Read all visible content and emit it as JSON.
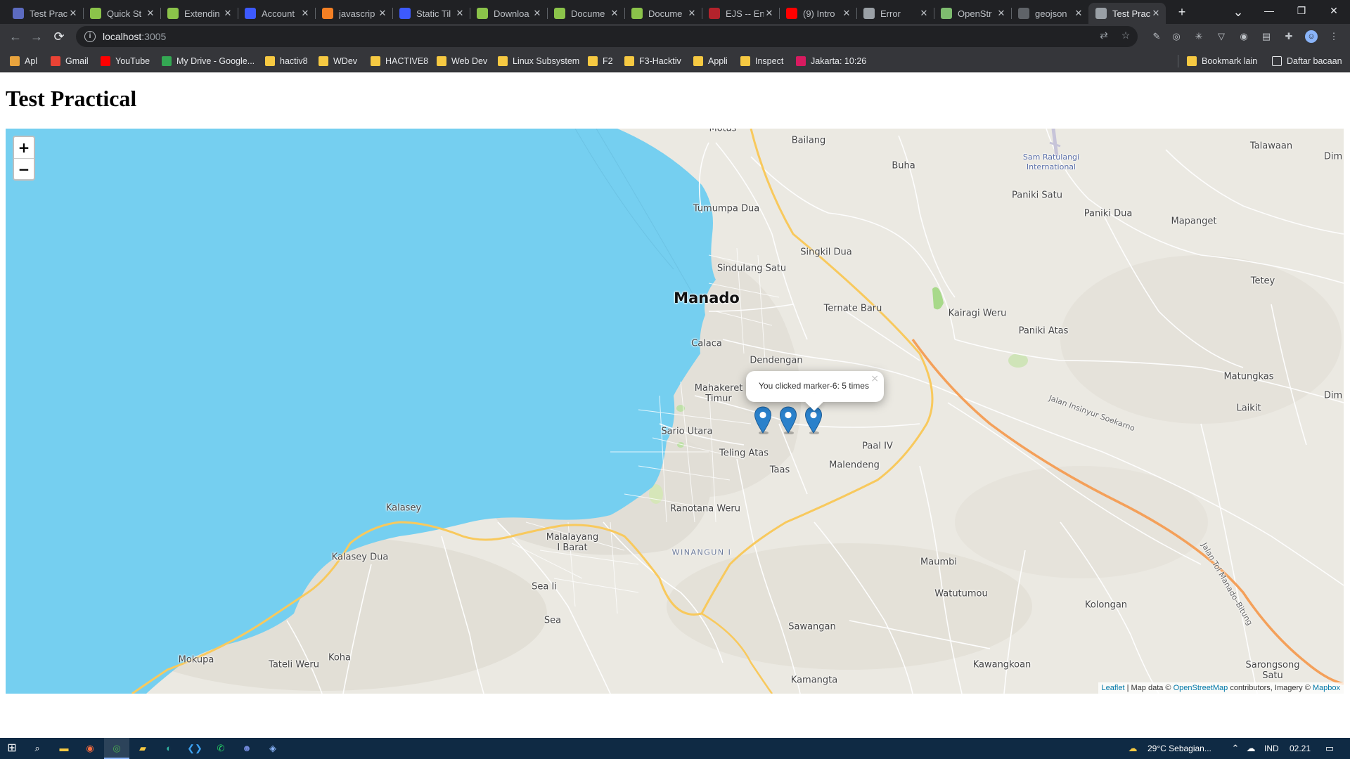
{
  "browser": {
    "tabs": [
      {
        "title": "Test Prac",
        "favicon_color": "#5c6bc0",
        "active": false
      },
      {
        "title": "Quick St",
        "favicon_color": "#8bc34a",
        "active": false
      },
      {
        "title": "Extendin",
        "favicon_color": "#8bc34a",
        "active": false
      },
      {
        "title": "Account",
        "favicon_color": "#3d5afe",
        "active": false
      },
      {
        "title": "javascrip",
        "favicon_color": "#f48024",
        "active": false
      },
      {
        "title": "Static Til",
        "favicon_color": "#3d5afe",
        "active": false
      },
      {
        "title": "Downloa",
        "favicon_color": "#8bc34a",
        "active": false
      },
      {
        "title": "Docume",
        "favicon_color": "#8bc34a",
        "active": false
      },
      {
        "title": "Docume",
        "favicon_color": "#8bc34a",
        "active": false
      },
      {
        "title": "EJS -- En",
        "favicon_color": "#b4232c",
        "active": false
      },
      {
        "title": "(9) Intro",
        "favicon_color": "#ff0000",
        "active": false
      },
      {
        "title": "Error",
        "favicon_color": "#9aa0a6",
        "active": false
      },
      {
        "title": "OpenStr",
        "favicon_color": "#7ebc6f",
        "active": false
      },
      {
        "title": "geojson",
        "favicon_color": "#5f6368",
        "active": false
      },
      {
        "title": "Test Prac",
        "favicon_color": "#9aa0a6",
        "active": true
      }
    ],
    "new_tab_label": "+",
    "url": {
      "host": "localhost",
      "port": ":3005"
    },
    "bookmarks": [
      {
        "label": "Apl",
        "icon": "grid-icon",
        "color": "#e8a33d"
      },
      {
        "label": "Gmail",
        "icon": "gmail-icon",
        "color": "#ea4335"
      },
      {
        "label": "YouTube",
        "icon": "youtube-icon",
        "color": "#ff0000"
      },
      {
        "label": "My Drive - Google...",
        "icon": "drive-icon",
        "color": "#34a853"
      },
      {
        "label": "hactiv8",
        "icon": "folder-icon",
        "color": "#f6c942"
      },
      {
        "label": "WDev",
        "icon": "folder-icon",
        "color": "#f6c942"
      },
      {
        "label": "HACTIVE8",
        "icon": "folder-icon",
        "color": "#f6c942"
      },
      {
        "label": "Web Dev",
        "icon": "folder-icon",
        "color": "#f6c942"
      },
      {
        "label": "Linux Subsystem",
        "icon": "folder-icon",
        "color": "#f6c942"
      },
      {
        "label": "F2",
        "icon": "folder-icon",
        "color": "#f6c942"
      },
      {
        "label": "F3-Hacktiv",
        "icon": "folder-icon",
        "color": "#f6c942"
      },
      {
        "label": "Appli",
        "icon": "folder-icon",
        "color": "#f6c942"
      },
      {
        "label": "Inspect",
        "icon": "folder-icon",
        "color": "#f6c942"
      },
      {
        "label": "Jakarta: 10:26",
        "icon": "clock-site-icon",
        "color": "#d81b60"
      }
    ],
    "other_bookmarks": "Bookmark lain",
    "reading_list": "Daftar bacaan"
  },
  "page": {
    "title": "Test Practical"
  },
  "map": {
    "zoom_in": "+",
    "zoom_out": "−",
    "sea_color": "#75cff0",
    "land_color": "#ebe9e2",
    "places": [
      {
        "name": "Manado",
        "kind": "city"
      },
      {
        "name": "Bailang",
        "kind": "place"
      },
      {
        "name": "Buha",
        "kind": "place"
      },
      {
        "name": "Sam Ratulangi International",
        "kind": "airport"
      },
      {
        "name": "Talawaan",
        "kind": "place"
      },
      {
        "name": "Paniki Satu",
        "kind": "place"
      },
      {
        "name": "Paniki Dua",
        "kind": "place"
      },
      {
        "name": "Mapanget",
        "kind": "place"
      },
      {
        "name": "Tumumpa Dua",
        "kind": "place"
      },
      {
        "name": "Singkil Dua",
        "kind": "place"
      },
      {
        "name": "Sindulang Satu",
        "kind": "place"
      },
      {
        "name": "Ternate Baru",
        "kind": "place"
      },
      {
        "name": "Kairagi Weru",
        "kind": "place"
      },
      {
        "name": "Tetey",
        "kind": "place"
      },
      {
        "name": "Paniki Atas",
        "kind": "place"
      },
      {
        "name": "Calaca",
        "kind": "place"
      },
      {
        "name": "Dendengan",
        "kind": "place"
      },
      {
        "name": "Mahakeret Timur",
        "kind": "place"
      },
      {
        "name": "Matungkas",
        "kind": "place"
      },
      {
        "name": "Laikit",
        "kind": "place"
      },
      {
        "name": "Jalan Insinyur Soekarno",
        "kind": "road"
      },
      {
        "name": "Sario Utara",
        "kind": "place"
      },
      {
        "name": "Teling Atas",
        "kind": "place"
      },
      {
        "name": "Paal IV",
        "kind": "place"
      },
      {
        "name": "Malendeng",
        "kind": "place"
      },
      {
        "name": "Taas",
        "kind": "place"
      },
      {
        "name": "Kalasey",
        "kind": "place"
      },
      {
        "name": "Ranotana Weru",
        "kind": "place"
      },
      {
        "name": "Malalayang I Barat",
        "kind": "place"
      },
      {
        "name": "WINANGUN I",
        "kind": "district"
      },
      {
        "name": "Kalasey Dua",
        "kind": "place"
      },
      {
        "name": "Maumbi",
        "kind": "place"
      },
      {
        "name": "Sea Ii",
        "kind": "place"
      },
      {
        "name": "Watutumou",
        "kind": "place"
      },
      {
        "name": "Kolongan",
        "kind": "place"
      },
      {
        "name": "Sea",
        "kind": "place"
      },
      {
        "name": "Sawangan",
        "kind": "place"
      },
      {
        "name": "Mokupa",
        "kind": "place"
      },
      {
        "name": "Tateli Weru",
        "kind": "place"
      },
      {
        "name": "Koha",
        "kind": "place"
      },
      {
        "name": "Kawangkoan",
        "kind": "place"
      },
      {
        "name": "Sarongsong Satu",
        "kind": "place"
      },
      {
        "name": "Kamangta",
        "kind": "place"
      },
      {
        "name": "Motas",
        "kind": "place"
      },
      {
        "name": "Dim",
        "kind": "place"
      },
      {
        "name": "Jalan Tol Manado–Bitung",
        "kind": "road"
      }
    ],
    "markers": [
      "marker-4",
      "marker-5",
      "marker-6"
    ],
    "marker_color": "#2a81cb",
    "popup": {
      "text": "You clicked marker-6: 5 times",
      "close": "×"
    },
    "attribution": {
      "leaflet": "Leaflet",
      "sep": " | Map data © ",
      "osm": "OpenStreetMap",
      "middle": " contributors, Imagery © ",
      "mapbox": "Mapbox"
    }
  },
  "taskbar": {
    "weather": "29°C  Sebagian...",
    "language": "IND",
    "time": "02.21"
  }
}
